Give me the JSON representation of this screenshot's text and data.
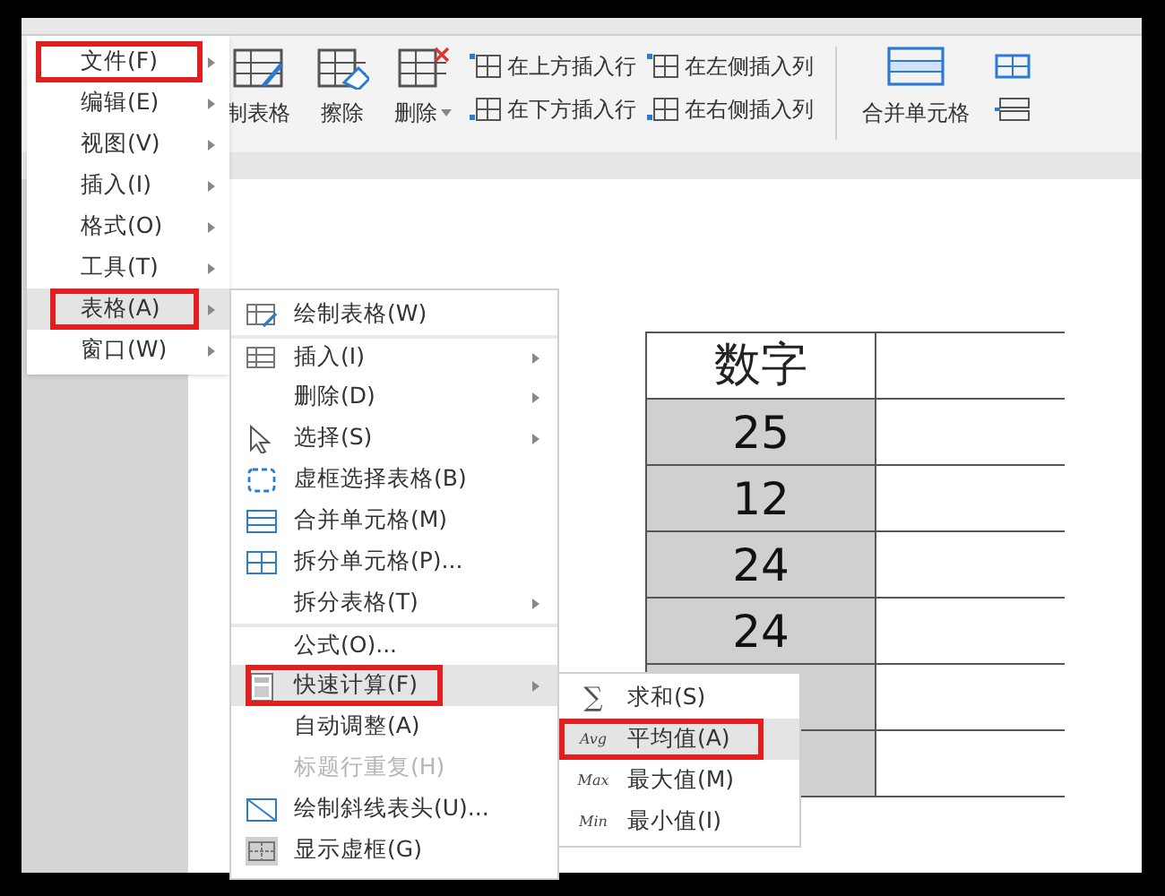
{
  "ribbon": {
    "large_buttons": [
      {
        "label": "制表格",
        "dropdown": false
      },
      {
        "label": "擦除",
        "dropdown": false
      },
      {
        "label": "删除",
        "dropdown": true
      }
    ],
    "row_buttons": [
      {
        "label": "在上方插入行"
      },
      {
        "label": "在下方插入行"
      },
      {
        "label": "在左侧插入列"
      },
      {
        "label": "在右侧插入列"
      }
    ],
    "merge_button": {
      "label": "合并单元格"
    }
  },
  "menu": {
    "items": [
      {
        "label": "文件(F)",
        "selected": false,
        "annotated": true
      },
      {
        "label": "编辑(E)",
        "selected": false,
        "annotated": false
      },
      {
        "label": "视图(V)",
        "selected": false,
        "annotated": false
      },
      {
        "label": "插入(I)",
        "selected": false,
        "annotated": false
      },
      {
        "label": "格式(O)",
        "selected": false,
        "annotated": false
      },
      {
        "label": "工具(T)",
        "selected": false,
        "annotated": false
      },
      {
        "label": "表格(A)",
        "selected": true,
        "annotated": true
      },
      {
        "label": "窗口(W)",
        "selected": false,
        "annotated": false
      }
    ]
  },
  "table_menu": {
    "items": [
      {
        "label": "绘制表格(W)",
        "submenu": false,
        "selected": false,
        "annotated": false,
        "disabled": false,
        "separator_before": false
      },
      {
        "label": "插入(I)",
        "submenu": true,
        "selected": false,
        "annotated": false,
        "disabled": false,
        "separator_before": true
      },
      {
        "label": "删除(D)",
        "submenu": true,
        "selected": false,
        "annotated": false,
        "disabled": false,
        "separator_before": false
      },
      {
        "label": "选择(S)",
        "submenu": true,
        "selected": false,
        "annotated": false,
        "disabled": false,
        "separator_before": false
      },
      {
        "label": "虚框选择表格(B)",
        "submenu": false,
        "selected": false,
        "annotated": false,
        "disabled": false,
        "separator_before": false
      },
      {
        "label": "合并单元格(M)",
        "submenu": false,
        "selected": false,
        "annotated": false,
        "disabled": false,
        "separator_before": false
      },
      {
        "label": "拆分单元格(P)...",
        "submenu": false,
        "selected": false,
        "annotated": false,
        "disabled": false,
        "separator_before": false
      },
      {
        "label": "拆分表格(T)",
        "submenu": true,
        "selected": false,
        "annotated": false,
        "disabled": false,
        "separator_before": false
      },
      {
        "label": "公式(O)...",
        "submenu": false,
        "selected": false,
        "annotated": false,
        "disabled": false,
        "separator_before": true
      },
      {
        "label": "快速计算(F)",
        "submenu": true,
        "selected": true,
        "annotated": true,
        "disabled": false,
        "separator_before": false
      },
      {
        "label": "自动调整(A)",
        "submenu": false,
        "selected": false,
        "annotated": false,
        "disabled": false,
        "separator_before": false
      },
      {
        "label": "标题行重复(H)",
        "submenu": false,
        "selected": false,
        "annotated": false,
        "disabled": true,
        "separator_before": false
      },
      {
        "label": "绘制斜线表头(U)...",
        "submenu": false,
        "selected": false,
        "annotated": false,
        "disabled": false,
        "separator_before": false
      },
      {
        "label": "显示虚框(G)",
        "submenu": false,
        "selected": false,
        "annotated": false,
        "disabled": false,
        "separator_before": false
      }
    ]
  },
  "calc_menu": {
    "items": [
      {
        "icon_text": "∑",
        "label": "求和(S)",
        "selected": false,
        "annotated": false
      },
      {
        "icon_text": "Avg",
        "label": "平均值(A)",
        "selected": true,
        "annotated": true
      },
      {
        "icon_text": "Max",
        "label": "最大值(M)",
        "selected": false,
        "annotated": false
      },
      {
        "icon_text": "Min",
        "label": "最小值(I)",
        "selected": false,
        "annotated": false
      }
    ]
  },
  "table": {
    "header": "数字",
    "rows": [
      {
        "value": "25"
      },
      {
        "value": "12"
      },
      {
        "value": "24"
      },
      {
        "value": "24"
      }
    ]
  }
}
